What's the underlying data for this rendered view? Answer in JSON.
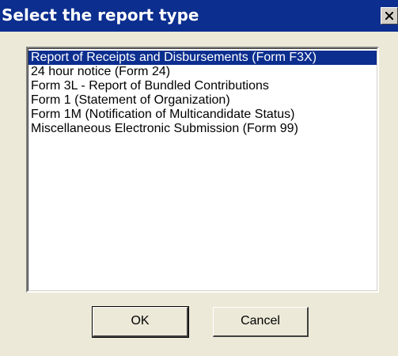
{
  "window": {
    "title": "Select the report type",
    "close_icon": "close-icon"
  },
  "report_list": {
    "items": [
      "Report of Receipts and Disbursements (Form F3X)",
      "24 hour notice (Form 24)",
      "Form 3L - Report of Bundled Contributions",
      "Form 1 (Statement of Organization)",
      "Form 1M (Notification of Multicandidate Status)",
      "Miscellaneous Electronic Submission (Form 99)"
    ],
    "selected_index": 0
  },
  "buttons": {
    "ok_label": "OK",
    "cancel_label": "Cancel"
  },
  "colors": {
    "title_bar": "#0b2e8f",
    "selection": "#0b2e8f",
    "dialog_bg": "#ece9d8"
  }
}
